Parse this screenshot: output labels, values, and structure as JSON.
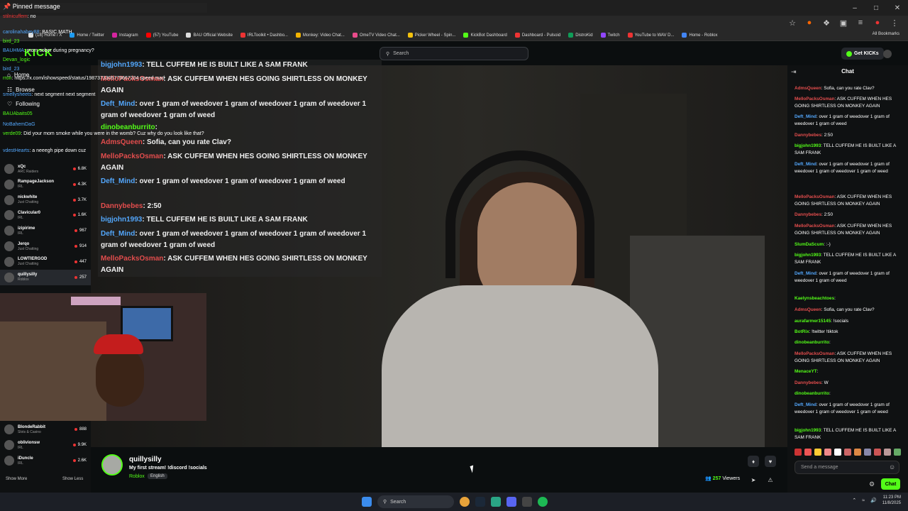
{
  "pinned": {
    "title": "Pinned message",
    "user": "stilnicuffem",
    "text": ": no"
  },
  "browser": {
    "bookmarks": [
      {
        "label": "KICK",
        "color": "#53fc18"
      },
      {
        "label": "(18) Home / X",
        "color": "#ddd"
      },
      {
        "label": "Home / Twitter",
        "color": "#1d9bf0"
      },
      {
        "label": "Instagram",
        "color": "#d6249f"
      },
      {
        "label": "(57) YouTube",
        "color": "#ff0000"
      },
      {
        "label": "BAU Official Website",
        "color": "#ddd"
      },
      {
        "label": "IRLToolkit • Dashbo...",
        "color": "#e33"
      },
      {
        "label": "Monkey: Video Chat...",
        "color": "#f4b400"
      },
      {
        "label": "OmeTV Video Chat...",
        "color": "#e94b8a"
      },
      {
        "label": "Picker Wheel - Spin...",
        "color": "#f4c20d"
      },
      {
        "label": "KickBot Dashboard",
        "color": "#53fc18"
      },
      {
        "label": "Dashboard - Pulsoid",
        "color": "#e33"
      },
      {
        "label": "DistroKid",
        "color": "#0f9d58"
      },
      {
        "label": "Twitch",
        "color": "#9146ff"
      },
      {
        "label": "YouTube to WAV D...",
        "color": "#e33"
      },
      {
        "label": "Home - Roblox",
        "color": "#4285f4"
      }
    ],
    "all_bookmarks": "All Bookmarks"
  },
  "header": {
    "search_placeholder": "Search",
    "get_kicks": "Get KICKs"
  },
  "nav": {
    "home": "Home",
    "browse": "Browse",
    "following": "Following"
  },
  "top_left_chat": [
    {
      "user": "carolinahabey88",
      "text": ": BASIC MATH"
    },
    {
      "user": "bird_23",
      "text": ""
    },
    {
      "user": "BAUHMA",
      "text": ": mom sober during pregnancy?"
    },
    {
      "user": "Devan_logic",
      "text": ""
    },
    {
      "user": "bird_23",
      "text": ""
    },
    {
      "user": "rron",
      "text": ": https://x.com/ishowspeed/status/1987373305779667204 speed mad"
    },
    {
      "user": "smellysheets",
      "text": ": next segment next segment"
    },
    {
      "user": "BAUAbaits05",
      "text": ""
    },
    {
      "user": "NoBahemDaG",
      "text": ""
    },
    {
      "user": "verde09",
      "text": ": Did your mom smoke while you were in the womb? Cuz why do you look like that?"
    },
    {
      "user": "vdestHearts",
      "text": ": a neeegh pipe down cuz"
    }
  ],
  "sidebar": {
    "channels": [
      {
        "name": "xQc",
        "category": "ARC Raiders",
        "viewers": "6.8K"
      },
      {
        "name": "RampageJackson",
        "category": "IRL",
        "viewers": "4.3K"
      },
      {
        "name": "nickwhite",
        "category": "Just Chatting",
        "viewers": "3.7K"
      },
      {
        "name": "Clavicular0",
        "category": "IRL",
        "viewers": "1.6K"
      },
      {
        "name": "izipirime",
        "category": "IRL",
        "viewers": "967"
      },
      {
        "name": "Jerqo",
        "category": "Just Chatting",
        "viewers": "914"
      },
      {
        "name": "LOWTIERGOD",
        "category": "Just Chatting",
        "viewers": "447"
      },
      {
        "name": "quillysilly",
        "category": "Roblox",
        "viewers": "257"
      }
    ],
    "channels_bottom": [
      {
        "name": "BlondeRabbit",
        "category": "Slots & Casino",
        "viewers": "888"
      },
      {
        "name": "oblivionsw",
        "category": "IRL",
        "viewers": "9.9K"
      },
      {
        "name": "iDuncle",
        "category": "IRL",
        "viewers": "2.6K"
      }
    ],
    "show_more": "Show More",
    "show_less": "Show Less"
  },
  "overlay_chat": [
    {
      "user": "bigjohn1993",
      "text": ": TELL CUFFEM HE IS BUILT LIKE A SAM FRANK",
      "color": "#53a7fc"
    },
    {
      "user": "MelloPacksOsman",
      "text": ": ASK CUFFEM WHEN HES GOING SHIRTLESS ON MONKEY AGAIN",
      "color": "#e34d4d"
    },
    {
      "user": "Deft_Mind",
      "text": ": over 1 gram of weedover 1 gram of weedover 1 gram of weedover 1 gram of weedover 1 gram of weed",
      "color": "#53a7fc"
    },
    {
      "user": "dinobeanburrito",
      "text": ":",
      "color": "#53fc18"
    },
    {
      "user": "AdmsQueen",
      "text": ": Sofia, can you rate Clav?",
      "color": "#e34d4d"
    },
    {
      "user": "MelloPacksOsman",
      "text": ": ASK CUFFEM WHEN HES GOING SHIRTLESS ON MONKEY AGAIN",
      "color": "#e34d4d"
    },
    {
      "user": "Deft_Mind",
      "text": ": over 1 gram of weedover 1 gram of weedover 1 gram of weed",
      "color": "#53a7fc"
    },
    {
      "user": "Dannybebes",
      "text": ": 2:50",
      "color": "#e34d4d"
    },
    {
      "user": "bigjohn1993",
      "text": ": TELL CUFFEM HE IS BUILT LIKE A SAM FRANK",
      "color": "#53a7fc"
    },
    {
      "user": "Deft_Mind",
      "text": ": over 1 gram of weedover 1 gram of weedover 1 gram of weedover 1 gram of weedover 1 gram of weed",
      "color": "#53a7fc"
    },
    {
      "user": "MelloPacksOsman",
      "text": ": ASK CUFFEM WHEN HES GOING SHIRTLESS ON MONKEY AGAIN",
      "color": "#e34d4d"
    }
  ],
  "stream": {
    "name": "quillysilly",
    "title": "My first stream! !discord !socials",
    "category": "Roblox",
    "language": "English",
    "viewers": "257",
    "viewers_label": "Viewers"
  },
  "chat": {
    "title": "Chat",
    "messages": [
      {
        "user": "AdmsQueen",
        "text": ": Sofia, can you rate Clav?",
        "color": "#e34d4d"
      },
      {
        "user": "MelloPacksOsman",
        "text": ": ASK CUFFEM WHEN HES GOING SHIRTLESS ON MONKEY AGAIN",
        "color": "#e34d4d"
      },
      {
        "user": "Deft_Mind",
        "text": ": over 1 gram of weedover 1 gram of weedover 1 gram of weed",
        "color": "#53a7fc"
      },
      {
        "user": "Dannybebes",
        "text": ": 2:50",
        "color": "#e34d4d"
      },
      {
        "user": "bigjohn1993",
        "text": ": TELL CUFFEM HE IS BUILT LIKE A SAM FRANK",
        "color": "#53fc18"
      },
      {
        "user": "Deft_Mind",
        "text": ": over 1 gram of weedover 1 gram of weedover 1 gram of weedover 1 gram of weed",
        "color": "#53a7fc"
      },
      {
        "user": "MelloPacksOsman",
        "text": ": ASK CUFFEM WHEN HES GOING SHIRTLESS ON MONKEY AGAIN",
        "color": "#e34d4d"
      },
      {
        "user": "Dannybebes",
        "text": ": 2:50",
        "color": "#e34d4d"
      },
      {
        "user": "MelloPacksOsman",
        "text": ": ASK CUFFEM WHEN HES GOING SHIRTLESS ON MONKEY AGAIN",
        "color": "#e34d4d"
      },
      {
        "user": "SlumDaScum",
        "text": ": :-)",
        "color": "#53fc18"
      },
      {
        "user": "bigjohn1993",
        "text": ": TELL CUFFEM HE IS BUILT LIKE A SAM FRANK",
        "color": "#53fc18"
      },
      {
        "user": "Deft_Mind",
        "text": ": over 1 gram of weedover 1 gram of weedover 1 gram of weed",
        "color": "#53a7fc"
      },
      {
        "user": "Kaelynsbeachtoes",
        "text": ":",
        "color": "#53fc18"
      },
      {
        "user": "AdmsQueen",
        "text": ": Sofia, can you rate Clav?",
        "color": "#e34d4d"
      },
      {
        "user": "aurafarmer15145",
        "text": ": !socials",
        "color": "#53fc18"
      },
      {
        "user": "BotRix",
        "text": ": !twitter !tiktok",
        "color": "#53fc18"
      },
      {
        "user": "dinobeanburrito",
        "text": ":",
        "color": "#53fc18"
      },
      {
        "user": "MelloPacksOsman",
        "text": ": ASK CUFFEM WHEN HES GOING SHIRTLESS ON MONKEY AGAIN",
        "color": "#e34d4d"
      },
      {
        "user": "MenaceYT",
        "text": ":",
        "color": "#53fc18"
      },
      {
        "user": "Dannybebes",
        "text": ": W",
        "color": "#e34d4d"
      },
      {
        "user": "dinobeanburrito",
        "text": ":",
        "color": "#53fc18"
      },
      {
        "user": "Deft_Mind",
        "text": ": over 1 gram of weedover 1 gram of weedover 1 gram of weedover 1 gram of weed",
        "color": "#53a7fc"
      },
      {
        "user": "bigjohn1993",
        "text": ": TELL CUFFEM HE IS BUILT LIKE A SAM FRANK",
        "color": "#53fc18"
      }
    ],
    "input_placeholder": "Send a message",
    "send_label": "Chat"
  },
  "taskbar": {
    "search_label": "Search",
    "time": "11:23 PM",
    "date": "11/8/2025"
  }
}
